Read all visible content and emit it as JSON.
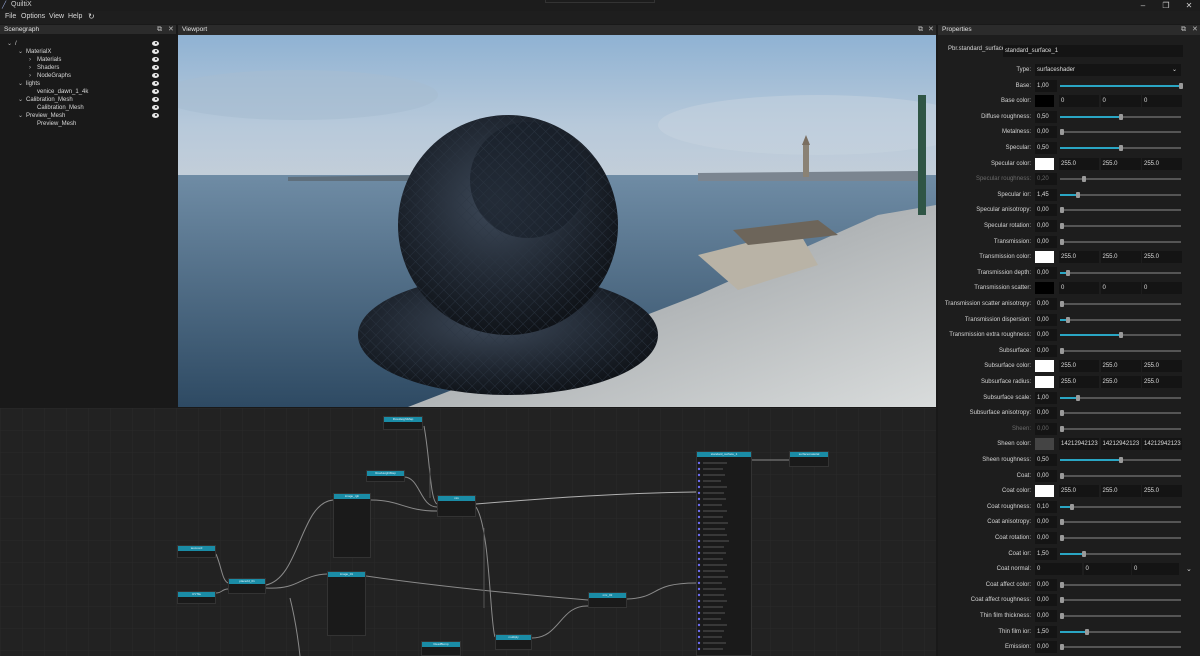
{
  "app": {
    "title": "QuiltiX",
    "logo_icon": "quiltix-logo-icon"
  },
  "window_controls": [
    "–",
    "❐",
    "✕"
  ],
  "menu": [
    "File",
    "Options",
    "View",
    "Help"
  ],
  "menu_refresh_icon": "refresh-icon",
  "scenegraph": {
    "title": "Scenegraph",
    "items": [
      {
        "label": "/",
        "level": 0,
        "arrow": "v",
        "eye": true
      },
      {
        "label": "MaterialX",
        "level": 1,
        "arrow": "v",
        "eye": true
      },
      {
        "label": "Materials",
        "level": 2,
        "arrow": ">",
        "eye": true
      },
      {
        "label": "Shaders",
        "level": 2,
        "arrow": ">",
        "eye": true
      },
      {
        "label": "NodeGraphs",
        "level": 2,
        "arrow": ">",
        "eye": true
      },
      {
        "label": "lights",
        "level": 1,
        "arrow": "v",
        "eye": true
      },
      {
        "label": "venice_dawn_1_4k",
        "level": 2,
        "arrow": "",
        "eye": true
      },
      {
        "label": "Calibration_Mesh",
        "level": 1,
        "arrow": "v",
        "eye": true
      },
      {
        "label": "Calibration_Mesh",
        "level": 2,
        "arrow": "",
        "eye": true
      },
      {
        "label": "Preview_Mesh",
        "level": 1,
        "arrow": "v",
        "eye": true
      },
      {
        "label": "Preview_Mesh",
        "level": 2,
        "arrow": "",
        "eye": false
      }
    ]
  },
  "viewport": {
    "title": "Viewport"
  },
  "properties": {
    "title": "Properties",
    "header_label": "Pbr.standard_surface",
    "header_value": "standard_surface_1",
    "rows": [
      {
        "label": "Type:",
        "kind": "dropdown",
        "value": "surfaceshader"
      },
      {
        "label": "Base:",
        "kind": "slider",
        "value": "1,00",
        "fill": 1.0
      },
      {
        "label": "Base color:",
        "kind": "color",
        "swatch": "#000000",
        "vals": [
          "0",
          "0",
          "0"
        ]
      },
      {
        "label": "Diffuse roughness:",
        "kind": "slider",
        "value": "0,50",
        "fill": 0.5
      },
      {
        "label": "Metalness:",
        "kind": "slider",
        "value": "0,00",
        "fill": 0.0
      },
      {
        "label": "Specular:",
        "kind": "slider",
        "value": "0,50",
        "fill": 0.5
      },
      {
        "label": "Specular color:",
        "kind": "color",
        "swatch": "#ffffff",
        "vals": [
          "255.0",
          "255.0",
          "255.0"
        ]
      },
      {
        "label": "Specular roughness:",
        "kind": "slider",
        "value": "0,20",
        "fill": 0.2,
        "disabled": true
      },
      {
        "label": "Specular ior:",
        "kind": "slider",
        "value": "1,45",
        "fill": 0.15
      },
      {
        "label": "Specular anisotropy:",
        "kind": "slider",
        "value": "0,00",
        "fill": 0.0
      },
      {
        "label": "Specular rotation:",
        "kind": "slider",
        "value": "0,00",
        "fill": 0.0
      },
      {
        "label": "Transmission:",
        "kind": "slider",
        "value": "0,00",
        "fill": 0.0
      },
      {
        "label": "Transmission color:",
        "kind": "color",
        "swatch": "#ffffff",
        "vals": [
          "255.0",
          "255.0",
          "255.0"
        ]
      },
      {
        "label": "Transmission depth:",
        "kind": "slider",
        "value": "0,00",
        "fill": 0.07
      },
      {
        "label": "Transmission scatter:",
        "kind": "color",
        "swatch": "#000000",
        "vals": [
          "0",
          "0",
          "0"
        ]
      },
      {
        "label": "Transmission scatter anisotropy:",
        "kind": "slider",
        "value": "0,00",
        "fill": 0.0
      },
      {
        "label": "Transmission dispersion:",
        "kind": "slider",
        "value": "0,00",
        "fill": 0.07
      },
      {
        "label": "Transmission extra roughness:",
        "kind": "slider",
        "value": "0,00",
        "fill": 0.5
      },
      {
        "label": "Subsurface:",
        "kind": "slider",
        "value": "0,00",
        "fill": 0.0
      },
      {
        "label": "Subsurface color:",
        "kind": "color",
        "swatch": "#ffffff",
        "vals": [
          "255.0",
          "255.0",
          "255.0"
        ]
      },
      {
        "label": "Subsurface radius:",
        "kind": "color",
        "swatch": "#ffffff",
        "vals": [
          "255.0",
          "255.0",
          "255.0"
        ]
      },
      {
        "label": "Subsurface scale:",
        "kind": "slider",
        "value": "1,00",
        "fill": 0.15
      },
      {
        "label": "Subsurface anisotropy:",
        "kind": "slider",
        "value": "0,00",
        "fill": 0.0
      },
      {
        "label": "Sheen:",
        "kind": "slider",
        "value": "0,00",
        "fill": 0.0,
        "disabled": true
      },
      {
        "label": "Sheen color:",
        "kind": "color",
        "swatch": "#444444",
        "vals": [
          "14212942123",
          "14212942123",
          "14212942123"
        ]
      },
      {
        "label": "Sheen roughness:",
        "kind": "slider",
        "value": "0,50",
        "fill": 0.5
      },
      {
        "label": "Coat:",
        "kind": "slider",
        "value": "0,00",
        "fill": 0.0
      },
      {
        "label": "Coat color:",
        "kind": "color",
        "swatch": "#ffffff",
        "vals": [
          "255.0",
          "255.0",
          "255.0"
        ]
      },
      {
        "label": "Coat roughness:",
        "kind": "slider",
        "value": "0,10",
        "fill": 0.1
      },
      {
        "label": "Coat anisotropy:",
        "kind": "slider",
        "value": "0,00",
        "fill": 0.0
      },
      {
        "label": "Coat rotation:",
        "kind": "slider",
        "value": "0,00",
        "fill": 0.0
      },
      {
        "label": "Coat ior:",
        "kind": "slider",
        "value": "1,50",
        "fill": 0.2
      },
      {
        "label": "Coat normal:",
        "kind": "vector",
        "vals": [
          "0",
          "0",
          "0"
        ]
      },
      {
        "label": "Coat affect color:",
        "kind": "slider",
        "value": "0,00",
        "fill": 0.0
      },
      {
        "label": "Coat affect roughness:",
        "kind": "slider",
        "value": "0,00",
        "fill": 0.0
      },
      {
        "label": "Thin film thickness:",
        "kind": "slider",
        "value": "0,00",
        "fill": 0.0
      },
      {
        "label": "Thin film ior:",
        "kind": "slider",
        "value": "1,50",
        "fill": 0.22
      },
      {
        "label": "Emission:",
        "kind": "slider",
        "value": "0,00",
        "fill": 0.0
      }
    ]
  },
  "colors": {
    "accent": "#2aa6c4",
    "node_header": "#1a8ca6"
  }
}
